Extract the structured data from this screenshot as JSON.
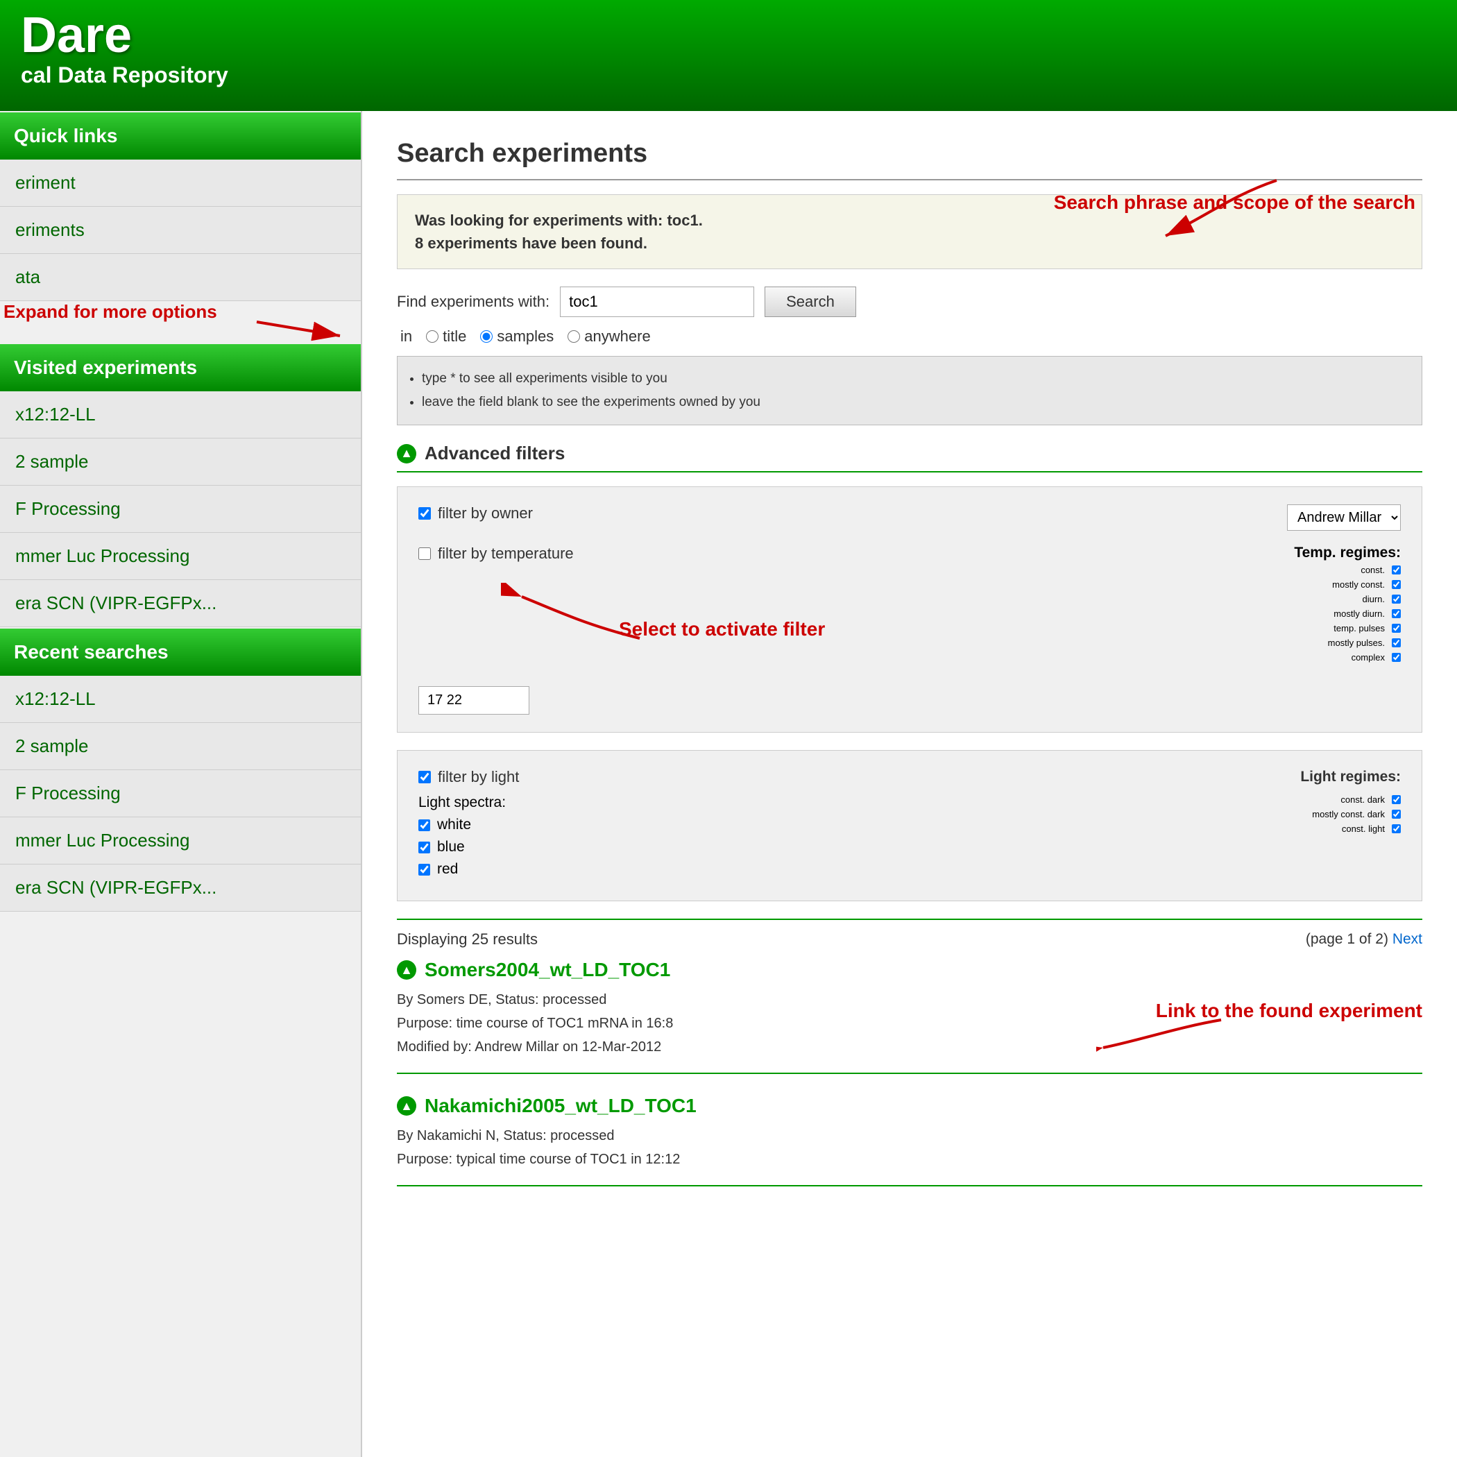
{
  "app": {
    "title": "Dare",
    "subtitle": "cal Data Repository"
  },
  "sidebar": {
    "quick_links_header": "Quick links",
    "quick_links_items": [
      "eriment",
      "eriments",
      "ata"
    ],
    "visited_header": "Visited experiments",
    "visited_items": [
      "x12:12-LL",
      "2 sample",
      "F Processing",
      "mmer Luc Processing",
      "era SCN (VIPR-EGFPx..."
    ],
    "recent_header": "Recent searches",
    "recent_items": [
      "x12:12-LL",
      "2 sample",
      "F Processing",
      "mmer Luc Processing",
      "era SCN (VIPR-EGFPx..."
    ]
  },
  "annotations": {
    "expand_label": "Expand for\nmore options",
    "search_phrase_label": "Search phrase and\nscope of the search",
    "select_filter_label": "Select to activate\nfilter",
    "link_experiment_label": "Link to the found\nexperiment"
  },
  "main": {
    "page_title": "Search experiments",
    "search_info": "Was looking for experiments with: toc1.\n8 experiments have been found.",
    "find_label": "Find experiments with:",
    "search_value": "toc1",
    "search_button": "Search",
    "in_label": "in",
    "radio_options": [
      "title",
      "samples",
      "anywhere"
    ],
    "radio_selected": "samples",
    "hints": [
      "type * to see all experiments visible to you",
      "leave the field blank to see the experiments owned by you"
    ],
    "advanced_filters_label": "Advanced filters",
    "filter_owner_label": "filter by owner",
    "owner_value": "Andrew Millar",
    "filter_temperature_label": "filter by temperature",
    "temp_value": "17 22",
    "temp_regimes_label": "Temp. regimes:",
    "temp_regimes": [
      {
        "label": "const.",
        "checked": true
      },
      {
        "label": "mostly const.",
        "checked": true
      },
      {
        "label": "diurn.",
        "checked": true
      },
      {
        "label": "mostly diurn.",
        "checked": true
      },
      {
        "label": "temp. pulses",
        "checked": true
      },
      {
        "label": "mostly pulses.",
        "checked": true
      },
      {
        "label": "complex",
        "checked": true
      }
    ],
    "filter_light_label": "filter by light",
    "light_regimes_label": "Light regimes:",
    "light_spectra_label": "Light spectra:",
    "light_spectra": [
      {
        "label": "white",
        "checked": true
      },
      {
        "label": "blue",
        "checked": true
      },
      {
        "label": "red",
        "checked": true
      }
    ],
    "light_regimes": [
      {
        "label": "const. dark",
        "checked": true
      },
      {
        "label": "mostly const. dark",
        "checked": true
      },
      {
        "label": "const. light",
        "checked": true
      }
    ],
    "results_count": "Displaying 25 results",
    "pagination": "(page 1 of 2)",
    "next_label": "Next",
    "experiments": [
      {
        "id": "Somers2004_wt_LD_TOC1",
        "by": "By Somers DE, Status: processed",
        "purpose": "Purpose: time course of TOC1 mRNA in 16:8",
        "modified": "Modified by: Andrew Millar on 12-Mar-2012"
      },
      {
        "id": "Nakamichi2005_wt_LD_TOC1",
        "by": "By Nakamichi N, Status: processed",
        "purpose": "Purpose: typical time course of TOC1 in 12:12"
      }
    ]
  }
}
